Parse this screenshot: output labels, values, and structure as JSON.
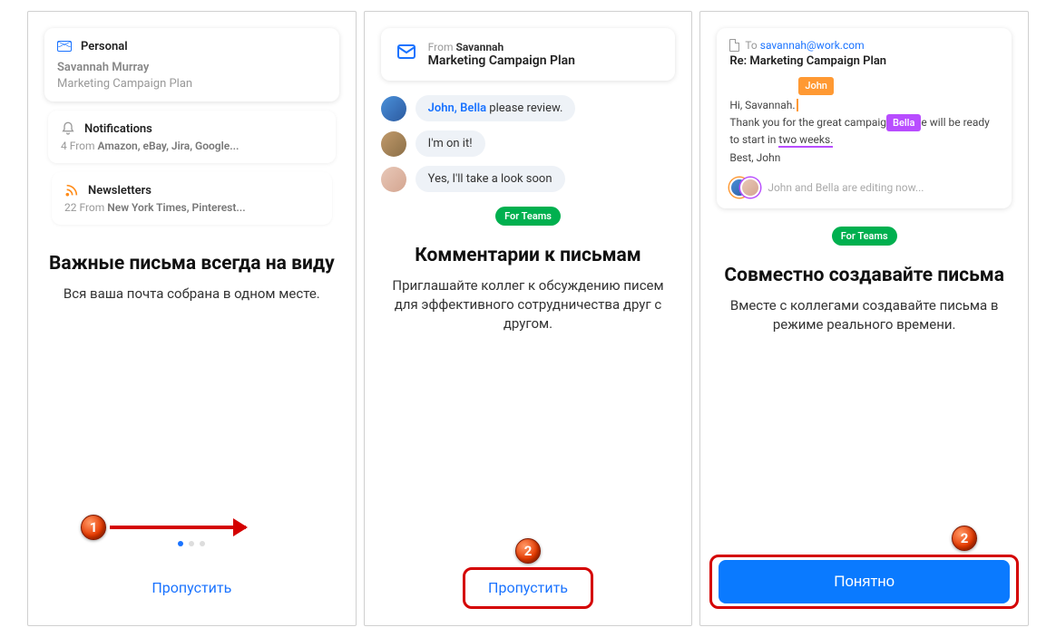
{
  "screen1": {
    "personal_label": "Personal",
    "sender": "Savannah Murray",
    "subject": "Marketing Campaign Plan",
    "notifications_label": "Notifications",
    "notifications_sub_prefix": "4 From ",
    "notifications_sub_bold": "Amazon, eBay, Jira, Google...",
    "newsletters_label": "Newsletters",
    "newsletters_sub_prefix": "22 From ",
    "newsletters_sub_bold": "New York Times, Pinterest...",
    "headline": "Важные письма всегда на виду",
    "sub": "Вся ваша почта собрана в одном месте.",
    "skip": "Пропустить",
    "marker": "1"
  },
  "screen2": {
    "from_label": "From ",
    "from_name": "Savannah",
    "subject": "Marketing Campaign Plan",
    "chat1_mentions": "John, Bella",
    "chat1_rest": " please review.",
    "chat2": "I'm on it!",
    "chat3": "Yes, I'll take a look soon",
    "badge": "For Teams",
    "headline": "Комментарии к письмам",
    "sub": "Приглашайте коллег к обсуждению писем для эффективного сотрудничества друг с другом.",
    "skip": "Пропустить",
    "marker": "2"
  },
  "screen3": {
    "to_label": "To ",
    "to_email": "savannah@work.com",
    "subject": "Re: Marketing Campaign Plan",
    "tag_john": "John",
    "tag_bella": "Bella",
    "body_l1a": "Hi, Savannah.",
    "body_l2a": "Thank you for the great campaig",
    "body_l2b": "e will be ready to start in ",
    "body_l2c": "two weeks.",
    "body_l3": "Best, John",
    "editing": "John and Bella are editing now...",
    "badge": "For Teams",
    "headline": "Совместно создавайте письма",
    "sub": "Вместе с коллегами создавайте письма в режиме реального времени.",
    "button": "Понятно",
    "marker": "2"
  }
}
